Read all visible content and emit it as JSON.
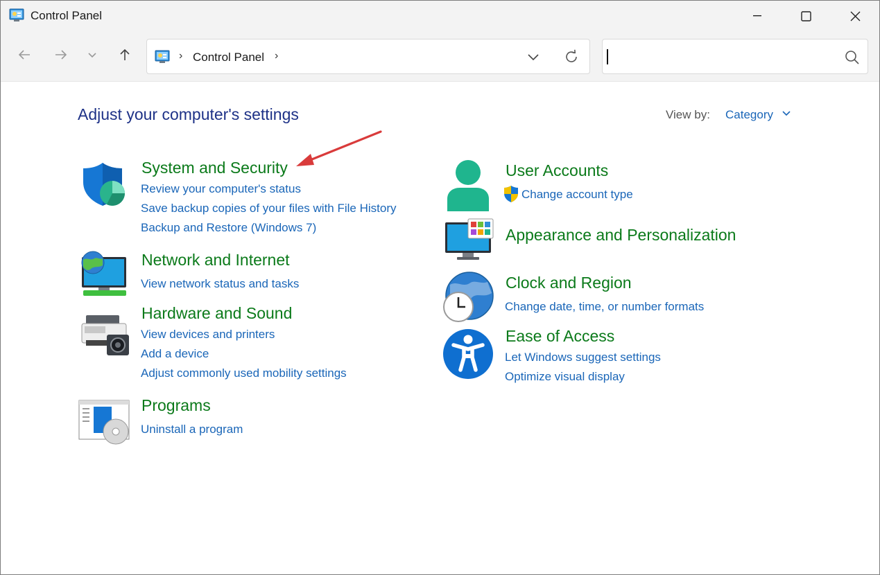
{
  "window": {
    "title": "Control Panel"
  },
  "address": {
    "segment": "Control Panel",
    "separator": "›"
  },
  "search": {
    "value": ""
  },
  "content": {
    "heading": "Adjust your computer's settings",
    "view_by_label": "View by:",
    "view_by_value": "Category"
  },
  "categories": {
    "system_security": {
      "title": "System and Security",
      "links": [
        "Review your computer's status",
        "Save backup copies of your files with File History",
        "Backup and Restore (Windows 7)"
      ]
    },
    "network": {
      "title": "Network and Internet",
      "links": [
        "View network status and tasks"
      ]
    },
    "hardware": {
      "title": "Hardware and Sound",
      "links": [
        "View devices and printers",
        "Add a device",
        "Adjust commonly used mobility settings"
      ]
    },
    "programs": {
      "title": "Programs",
      "links": [
        "Uninstall a program"
      ]
    },
    "user_accounts": {
      "title": "User Accounts",
      "links": [
        "Change account type"
      ]
    },
    "appearance": {
      "title": "Appearance and Personalization",
      "links": []
    },
    "clock": {
      "title": "Clock and Region",
      "links": [
        "Change date, time, or number formats"
      ]
    },
    "ease": {
      "title": "Ease of Access",
      "links": [
        "Let Windows suggest settings",
        "Optimize visual display"
      ]
    }
  },
  "colors": {
    "category_title": "#0b7a1a",
    "link": "#1a66b8",
    "heading": "#1e3287",
    "annotation_arrow": "#d93b3b"
  },
  "icons": [
    "control-panel-icon",
    "back-arrow-icon",
    "forward-arrow-icon",
    "recent-dropdown-icon",
    "up-arrow-icon",
    "chevron-down-icon",
    "refresh-icon",
    "search-icon",
    "shield-icon",
    "network-icon",
    "printer-icon",
    "programs-icon",
    "user-icon",
    "uac-shield-icon",
    "monitor-icon",
    "globe-clock-icon",
    "accessibility-icon"
  ]
}
